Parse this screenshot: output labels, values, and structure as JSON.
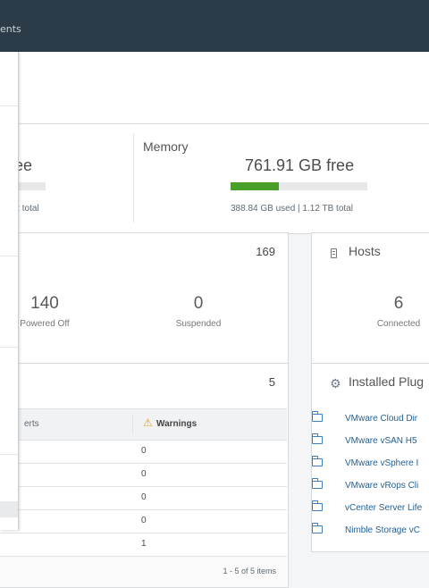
{
  "header": {
    "breadcrumb_fragment": "ents"
  },
  "cpu": {
    "free_fragment": "ee",
    "total_fragment": "z total",
    "used_fraction": 0.3
  },
  "memory": {
    "title": "Memory",
    "free": "761.91 GB free",
    "usage": "388.84 GB used | 1.12 TB total",
    "used_fraction": 0.35
  },
  "vms": {
    "count": "169",
    "stats": [
      {
        "value": "140",
        "label": "Powered Off"
      },
      {
        "value": "0",
        "label": "Suspended"
      }
    ]
  },
  "hosts": {
    "title": "Hosts",
    "value": "6",
    "label": "Connected"
  },
  "alerts": {
    "count": "5",
    "columns": {
      "alerts_fragment": "erts",
      "warnings": "Warnings"
    },
    "rows": [
      "0",
      "0",
      "0",
      "0",
      "1"
    ],
    "footer": "1 - 5 of 5 items"
  },
  "plugins": {
    "title": "Installed Plug",
    "items": [
      "VMware Cloud Dir",
      "VMware vSAN H5",
      "VMware vSphere I",
      "VMware vRops Cli",
      "vCenter Server Life",
      "Nimble Storage vC"
    ]
  },
  "colors": {
    "header_bg": "#2b3b47",
    "bar_fill": "#48a028",
    "link": "#1f5f94",
    "warning": "#e8a317"
  }
}
